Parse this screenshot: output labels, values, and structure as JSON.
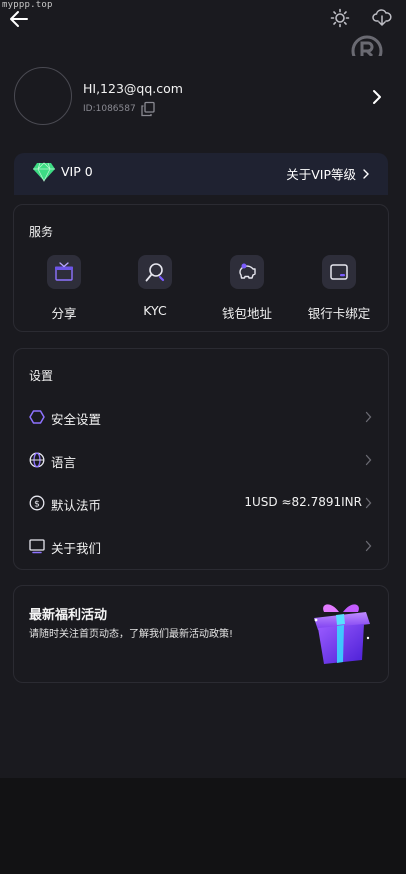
{
  "watermark": "myppp.top",
  "header": {
    "back_icon": "arrow-left-icon",
    "theme_icon": "sun-icon",
    "download_icon": "cloud-download-icon",
    "brand_icon": "registered-mark-icon"
  },
  "profile": {
    "username": "HI,123@qq.com",
    "id_text": "ID:1086587",
    "copy_icon": "copy-icon",
    "chevron_icon": "chevron-right-icon"
  },
  "vip": {
    "level": "VIP 0",
    "link_label": "关于VIP等级",
    "gem_icon": "diamond-icon"
  },
  "services": {
    "title": "服务",
    "items": [
      {
        "label": "分享",
        "icon": "gift-icon"
      },
      {
        "label": "KYC",
        "icon": "user-verify-icon"
      },
      {
        "label": "钱包地址",
        "icon": "piggy-bank-icon"
      },
      {
        "label": "银行卡绑定",
        "icon": "wallet-card-icon"
      }
    ]
  },
  "settings": {
    "title": "设置",
    "items": [
      {
        "label": "安全设置",
        "icon": "shield-hexagon-icon",
        "value": ""
      },
      {
        "label": "语言",
        "icon": "globe-icon",
        "value": ""
      },
      {
        "label": "默认法币",
        "icon": "dollar-coin-icon",
        "value": "1USD ≈82.7891INR"
      },
      {
        "label": "关于我们",
        "icon": "monitor-icon",
        "value": ""
      }
    ]
  },
  "promo": {
    "title": "最新福利活动",
    "subtitle": "请随时关注首页动态，了解我们最新活动政策!",
    "image_icon": "gift-box-icon"
  },
  "colors": {
    "background": "#1a1a1f",
    "card_border": "#2b2b32",
    "vip_bg": "#1f2231",
    "accent_purple": "#7b5cff",
    "gem_green": "#3ddc84"
  }
}
